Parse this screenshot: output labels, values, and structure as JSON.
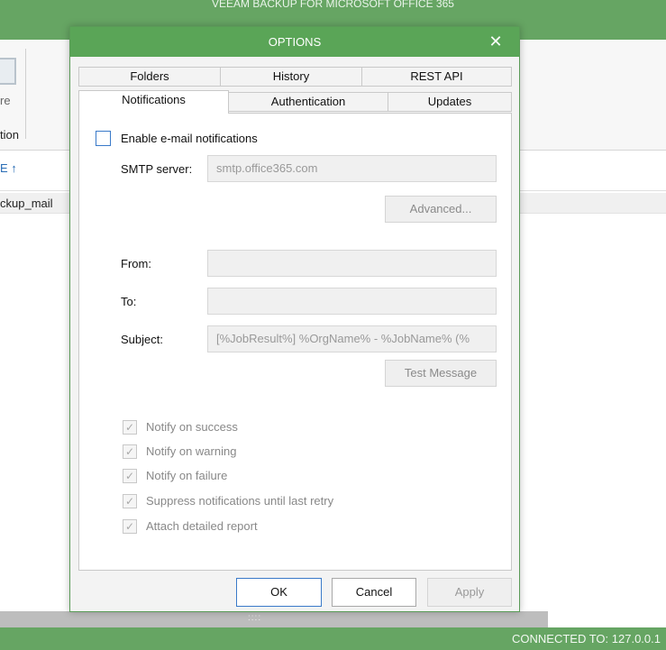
{
  "app": {
    "title": "VEEAM BACKUP FOR MICROSOFT OFFICE 365",
    "ribbon_button_label": "re",
    "ribbon_group_label": "tion",
    "list_header": "E ↑",
    "list_row": "ckup_mail",
    "scroll_grip": "::::",
    "status": "CONNECTED TO: 127.0.0.1"
  },
  "dialog": {
    "title": "OPTIONS",
    "close_glyph": "✕",
    "tabs_row1": [
      "Folders",
      "History",
      "REST API"
    ],
    "tabs_row2": [
      "Notifications",
      "Authentication",
      "Updates"
    ],
    "active_tab": "Notifications",
    "enable_label": "Enable e-mail notifications",
    "smtp_label": "SMTP server:",
    "smtp_value": "smtp.office365.com",
    "advanced_button": "Advanced...",
    "from_label": "From:",
    "from_value": "",
    "to_label": "To:",
    "to_value": "",
    "subject_label": "Subject:",
    "subject_value": "[%JobResult%] %OrgName% - %JobName% (%",
    "test_button": "Test Message",
    "check_glyph": "✓",
    "options": [
      "Notify on success",
      "Notify on warning",
      "Notify on failure",
      "Suppress notifications until last retry",
      "Attach detailed report"
    ],
    "ok": "OK",
    "cancel": "Cancel",
    "apply": "Apply"
  },
  "colors": {
    "brand_green": "#66a563",
    "dialog_green": "#5aa557",
    "focus_blue": "#3a7ac9"
  }
}
